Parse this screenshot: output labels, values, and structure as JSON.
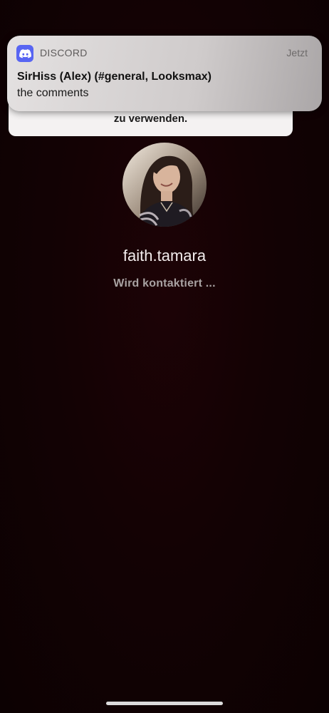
{
  "background_banner": {
    "text": "zu verwenden."
  },
  "notification": {
    "app_name": "DISCORD",
    "app_icon": "discord-logo-icon",
    "time": "Jetzt",
    "title": "SirHiss (Alex) (#general, Looksmax)",
    "body": "the comments",
    "accent_color": "#5865f2"
  },
  "call": {
    "contact_name": "faith.tamara",
    "status": "Wird kontaktiert ..."
  },
  "colors": {
    "background": "#130204"
  }
}
